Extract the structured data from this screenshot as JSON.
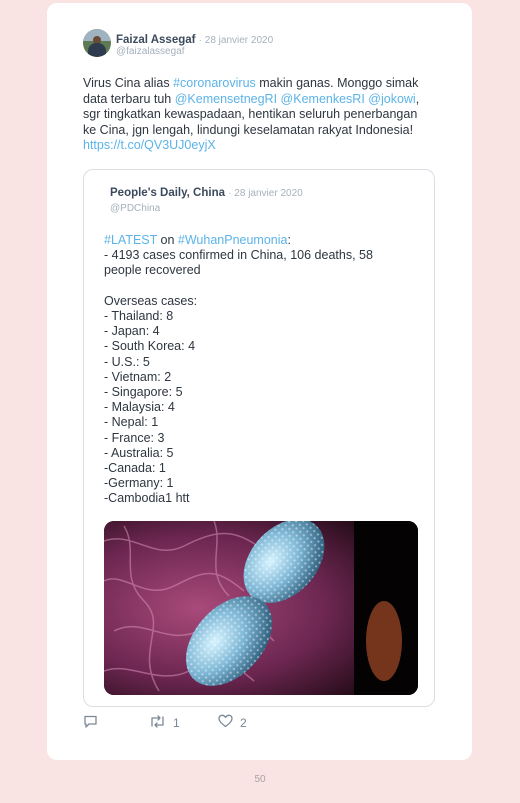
{
  "tweet": {
    "author_name": "Faizal Assegaf",
    "date": "· 28 janvier 2020",
    "handle": "@faizalassegaf",
    "text_segments": [
      {
        "t": "Virus Cina alias ",
        "link": false
      },
      {
        "t": "#coronarovirus",
        "link": true
      },
      {
        "t": " makin ganas. Monggo simak data terbaru tuh ",
        "link": false
      },
      {
        "t": "@KemensetnegRI",
        "link": true
      },
      {
        "t": " ",
        "link": false
      },
      {
        "t": "@KemenkesRI",
        "link": true
      },
      {
        "t": " ",
        "link": false
      },
      {
        "t": "@jokowi",
        "link": true
      },
      {
        "t": ", sgr tingkatkan kewaspadaan, hentikan seluruh penerbangan ke Cina, jgn lengah, lindungi keselamatan rakyat Indonesia! ",
        "link": false
      },
      {
        "t": "https://t.co/QV3UJ0eyjX",
        "link": true
      }
    ]
  },
  "quoted": {
    "author_name": "People's Daily, China",
    "date": "· 28 janvier 2020",
    "handle": "@PDChina",
    "hashtag_latest": "#LATEST",
    "on_word": " on ",
    "hashtag_wuhan": "#WuhanPneumonia",
    "colon": ":",
    "lines": [
      "- 4193 cases confirmed in China, 106 deaths, 58",
      "people recovered",
      "",
      "Overseas cases:",
      "- Thailand: 8",
      "- Japan: 4",
      "- South Korea: 4",
      "- U.S.: 5",
      "- Vietnam: 2",
      "- Singapore: 5",
      "- Malaysia: 4",
      "- Nepal: 1",
      "- France: 3",
      "- Australia: 5",
      "-Canada: 1",
      "-Germany: 1",
      "-Cambodia1 htt"
    ]
  },
  "actions": {
    "reply_icon": "reply-icon",
    "retweet_icon": "retweet-icon",
    "retweet_count": "1",
    "like_icon": "heart-icon",
    "like_count": "2"
  },
  "page_number": "50",
  "colors": {
    "background": "#fae4e3",
    "link": "#5bb3e8",
    "text": "#2e3640",
    "muted": "#a4b0bc"
  }
}
